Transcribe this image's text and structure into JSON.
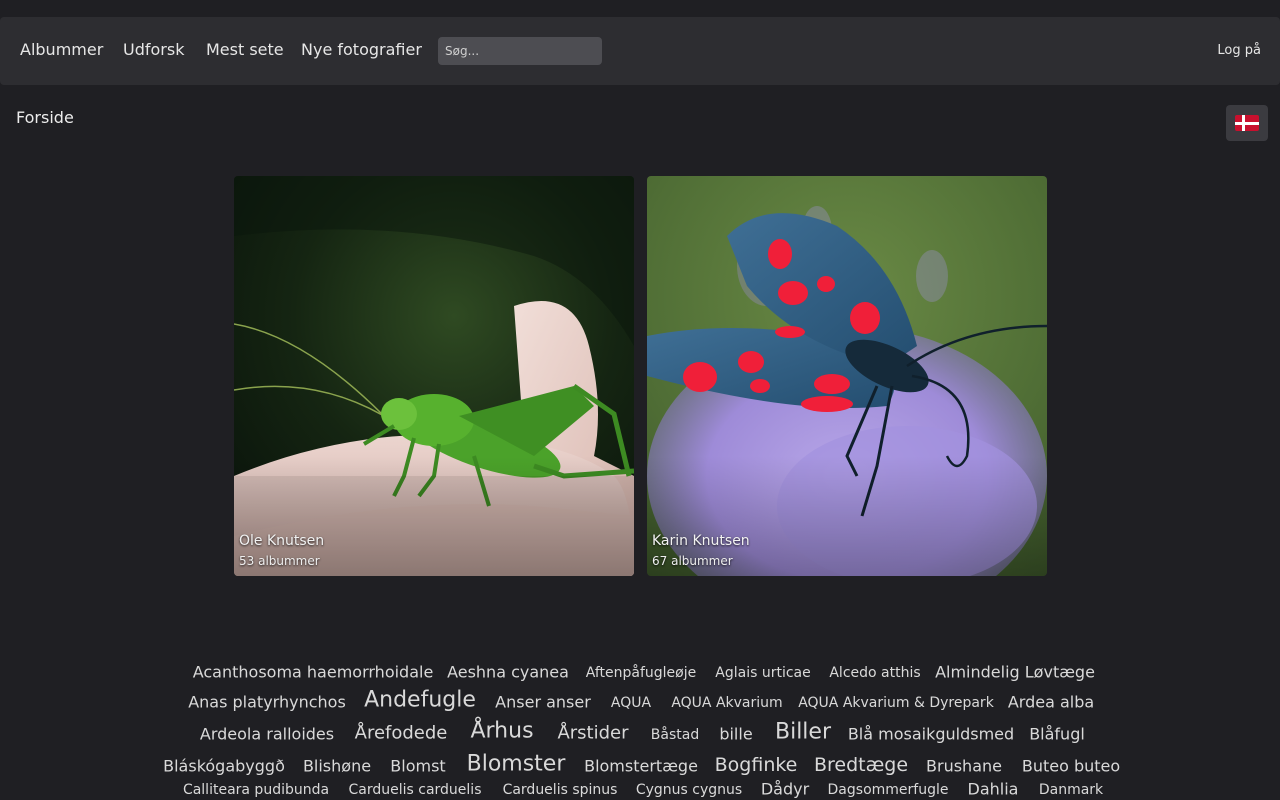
{
  "nav": {
    "items": [
      "Albummer",
      "Udforsk",
      "Mest sete",
      "Nye fotografier"
    ],
    "search_placeholder": "Søg...",
    "login": "Log på"
  },
  "breadcrumb": "Forside",
  "language": {
    "flag_icon": "flag-denmark-icon"
  },
  "albums": [
    {
      "title": "Ole Knutsen",
      "count": "53 albummer"
    },
    {
      "title": "Karin Knutsen",
      "count": "67 albummer"
    }
  ],
  "tags": [
    "Acanthosoma haemorrhoidale",
    "Aeshna cyanea",
    "Aftenpåfugleøje",
    "Aglais urticae",
    "Alcedo atthis",
    "Almindelig Løvtæge",
    "Anas platyrhynchos",
    "Andefugle",
    "Anser anser",
    "AQUA",
    "AQUA Akvarium",
    "AQUA Akvarium & Dyrepark",
    "Ardea alba",
    "Ardeola ralloides",
    "Årefodede",
    "Århus",
    "Årstider",
    "Båstad",
    "bille",
    "Biller",
    "Blå mosaikguldsmed",
    "Blåfugl",
    "Bláskógabyggð",
    "Blishøne",
    "Blomst",
    "Blomster",
    "Blomstertæge",
    "Bogfinke",
    "Bredtæge",
    "Brushane",
    "Buteo buteo",
    "Calliteara pudibunda",
    "Carduelis carduelis",
    "Carduelis spinus",
    "Cygnus cygnus",
    "Dådyr",
    "Dagsommerfugle",
    "Dahlia",
    "Danmark"
  ]
}
